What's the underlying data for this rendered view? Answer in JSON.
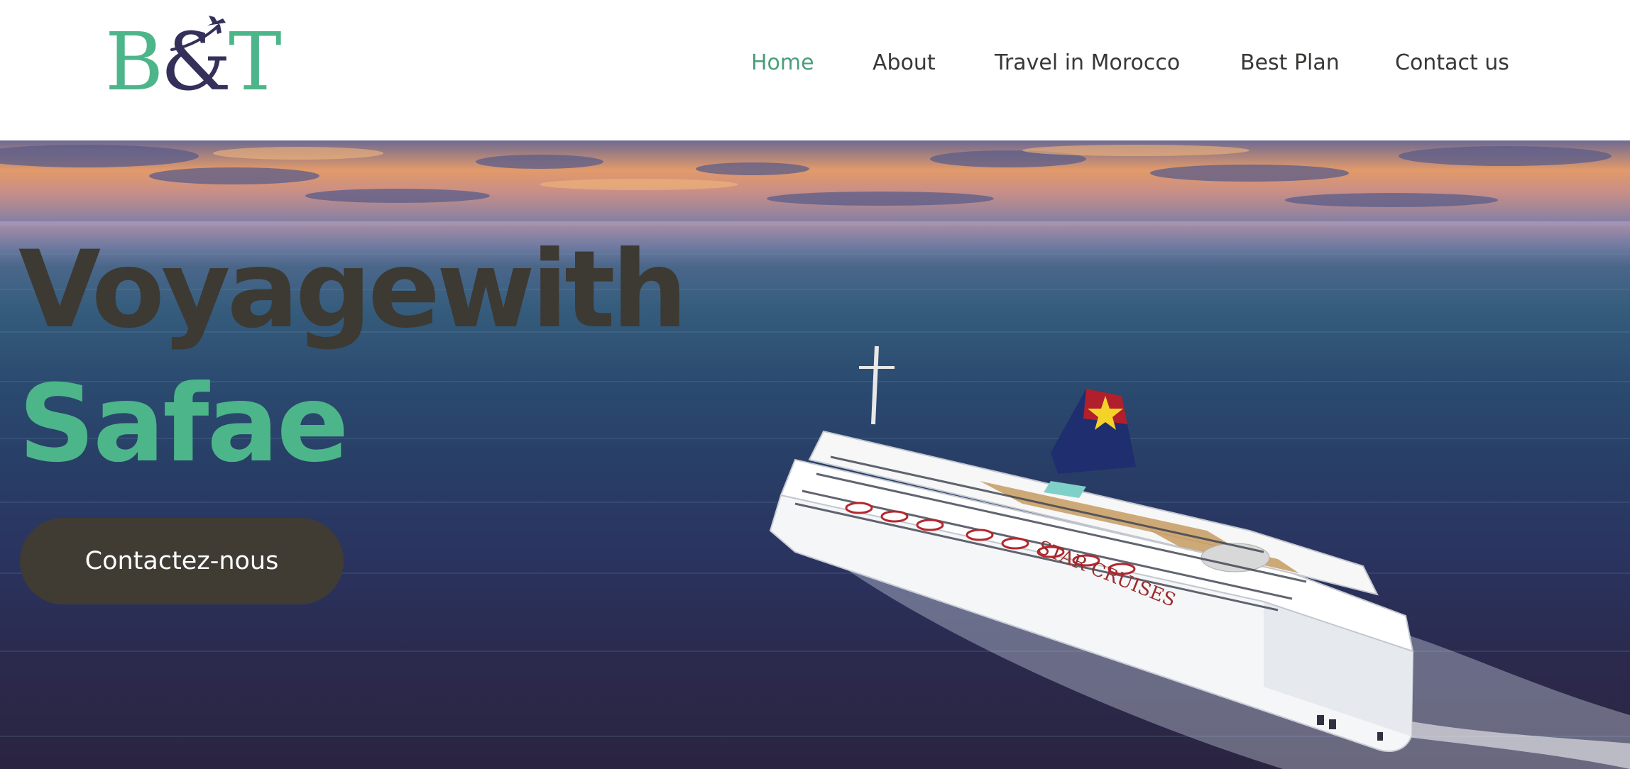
{
  "brand": {
    "logo_text": "B&T",
    "colors": {
      "primary_green": "#4db58a",
      "dark_navy": "#34305a",
      "dark_brown": "#3d3a33"
    }
  },
  "nav": {
    "items": [
      {
        "label": "Home",
        "active": true
      },
      {
        "label": "About",
        "active": false
      },
      {
        "label": "Travel in Morocco",
        "active": false
      },
      {
        "label": "Best Plan",
        "active": false
      },
      {
        "label": "Contact us",
        "active": false
      }
    ]
  },
  "hero": {
    "title_line1": "Voyagewith",
    "title_line2": "Safae",
    "cta_label": "Contactez-nous",
    "image": "cruise-ship-at-sea",
    "ship_name": "STAR CRUISES"
  }
}
